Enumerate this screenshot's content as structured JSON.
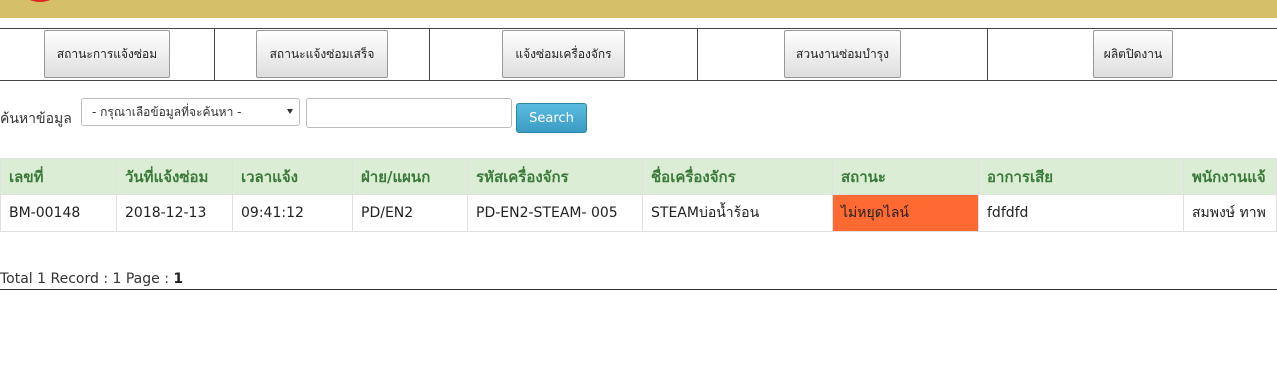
{
  "nav": {
    "items": [
      {
        "label": "สถานะการแจ้งซ่อม"
      },
      {
        "label": "สถานะแจ้งซ่อมเสร็จ"
      },
      {
        "label": "แจ้งซ่อมเครื่องจักร"
      },
      {
        "label": "สวนงานซ่อมบำรุง"
      },
      {
        "label": "ผลิตปิดงาน"
      }
    ]
  },
  "search": {
    "label": "ค้นหาข้อมูล",
    "select_value": "- กรุณาเลือข้อมูลที่จะค้นหา -",
    "input_value": "",
    "button_label": "Search"
  },
  "table": {
    "columns": [
      "เลขที่",
      "วันที่แจ้งซ่อม",
      "เวลาแจ้ง",
      "ฝ่าย/แผนก",
      "รหัสเครื่องจักร",
      "ชื่อเครื่องจักร",
      "สถานะ",
      "อาการเสีย",
      "พนักงานแจ้"
    ],
    "rows": [
      [
        "BM-00148",
        "2018-12-13",
        "09:41:12",
        "PD/EN2",
        "PD-EN2-STEAM- 005",
        "STEAMบ่อน้ำร้อน",
        "ไม่หยุดไลน์",
        "fdfdfd",
        "สมพงษ์ ทาพ"
      ]
    ],
    "status_color": "#ff6a33"
  },
  "footer": {
    "text": "Total 1 Record : 1 Page : ",
    "page": "1"
  },
  "colors": {
    "topbar": "#d5c069",
    "header_bg": "#dcedd5",
    "header_text": "#3c7a3b",
    "search_button": "#3a9cc4"
  }
}
